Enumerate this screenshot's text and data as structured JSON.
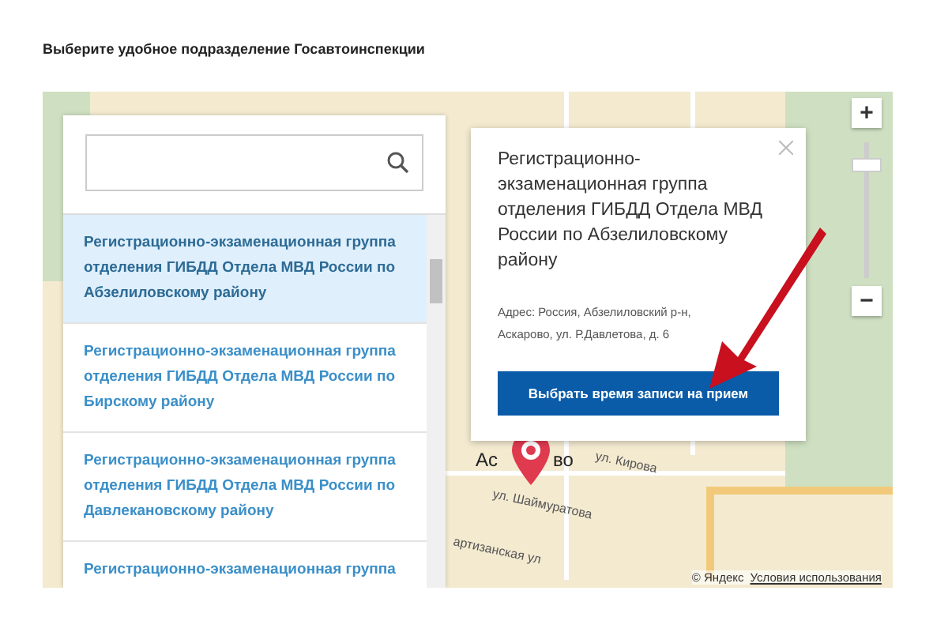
{
  "heading": "Выберите удобное подразделение Госавтоинспекции",
  "offices": [
    {
      "name": "Регистрационно-экзаменационная группа отделения ГИБДД Отдела МВД России по Абзелиловскому району",
      "selected": true
    },
    {
      "name": "Регистрационно-экзаменационная группа отделения ГИБДД Отдела МВД России по Бирскому району",
      "selected": false
    },
    {
      "name": "Регистрационно-экзаменационная группа отделения ГИБДД Отдела МВД России по Давлекановскому району",
      "selected": false
    },
    {
      "name": "Регистрационно-экзаменационная группа",
      "selected": false
    }
  ],
  "popup": {
    "title": "Регистрационно-экзаменационная группа отделения ГИБДД Отдела МВД России по Абзелиловскому району",
    "address": "Адрес: Россия, Абзелиловский р-н, Аскарово, ул. Р.Давлетова, д. 6",
    "button": "Выбрать время записи на прием"
  },
  "map": {
    "zoom_in": "+",
    "zoom_out": "−",
    "labels": [
      "ул. Кирова",
      "ул. Шаймуратова",
      "артизанская ул"
    ],
    "town": [
      "Ас",
      "во"
    ],
    "attribution": "© Яндекс",
    "terms": "Условия использования"
  }
}
